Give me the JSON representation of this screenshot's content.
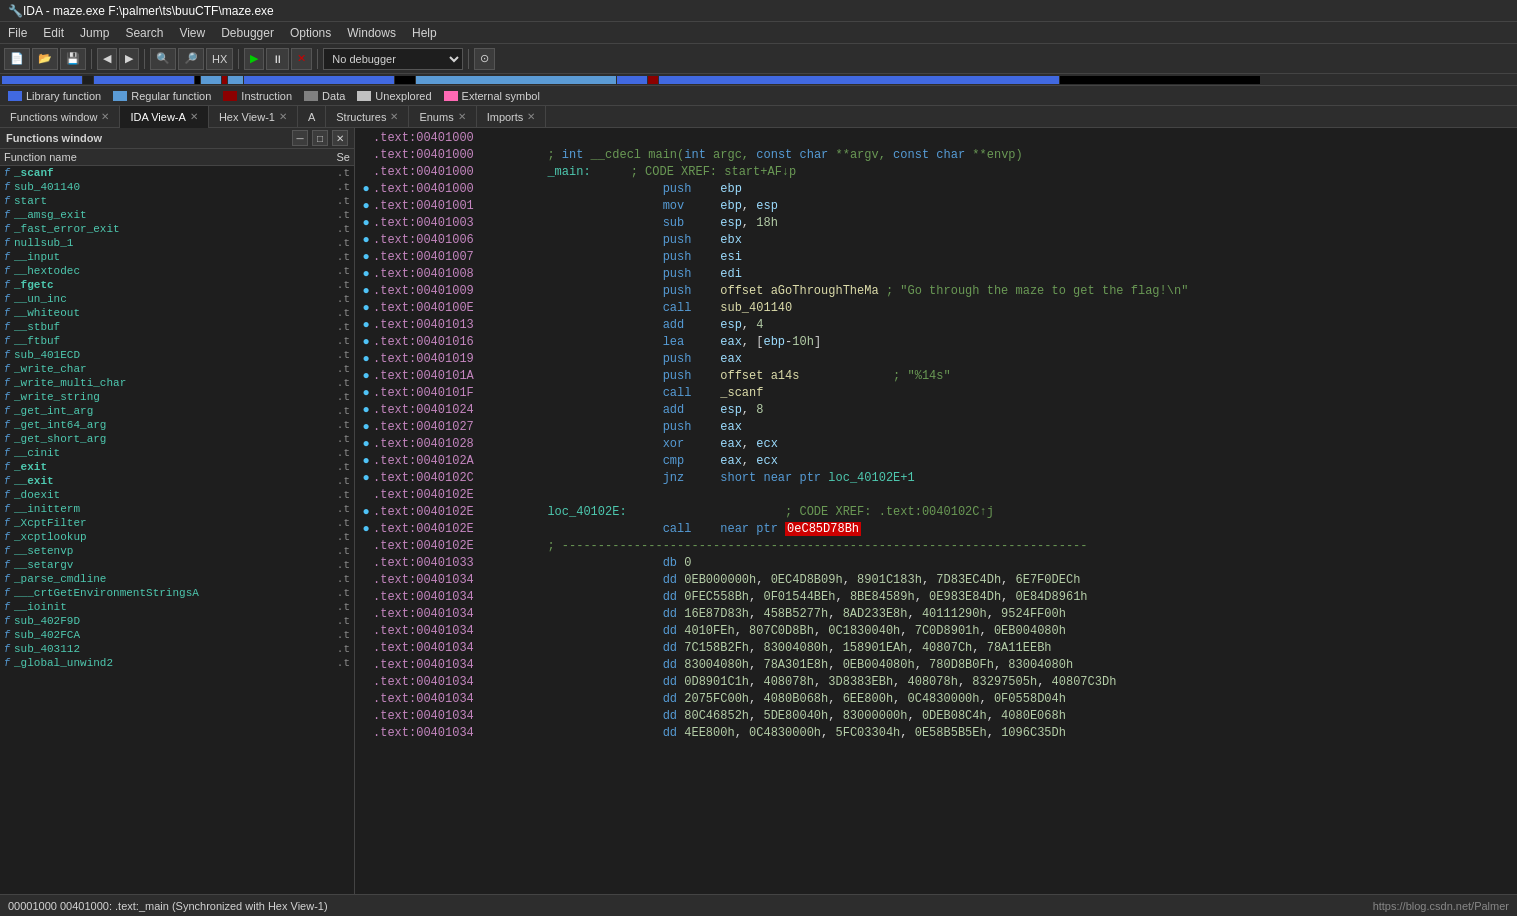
{
  "title_bar": {
    "icon": "🔧",
    "text": "IDA - maze.exe F:\\palmer\\ts\\buuCTF\\maze.exe"
  },
  "menu": {
    "items": [
      "File",
      "Edit",
      "Jump",
      "Search",
      "View",
      "Debugger",
      "Options",
      "Windows",
      "Help"
    ]
  },
  "legend": {
    "items": [
      {
        "color": "#4169e1",
        "label": "Library function"
      },
      {
        "color": "#5b9bd5",
        "label": "Regular function"
      },
      {
        "color": "#8b0000",
        "label": "Instruction"
      },
      {
        "color": "#808080",
        "label": "Data"
      },
      {
        "color": "#808080",
        "label": "Unexplored"
      },
      {
        "color": "#ff69b4",
        "label": "External symbol"
      }
    ]
  },
  "tabs": [
    {
      "label": "Functions window",
      "active": false,
      "closeable": true
    },
    {
      "label": "IDA View-A",
      "active": true,
      "closeable": true
    },
    {
      "label": "Hex View-1",
      "active": false,
      "closeable": true
    },
    {
      "label": "A",
      "active": false,
      "closeable": false
    },
    {
      "label": "Structures",
      "active": false,
      "closeable": true
    },
    {
      "label": "Enums",
      "active": false,
      "closeable": true
    },
    {
      "label": "Imports",
      "active": false,
      "closeable": true
    }
  ],
  "functions_panel": {
    "title": "Functions window",
    "col_name": "Function name",
    "col_seg": "Se",
    "functions": [
      {
        "name": "_scanf",
        "seg": ".t",
        "bold": true
      },
      {
        "name": "sub_401140",
        "seg": ".t",
        "bold": false
      },
      {
        "name": "start",
        "seg": ".t",
        "bold": false
      },
      {
        "name": "__amsg_exit",
        "seg": ".t",
        "bold": false
      },
      {
        "name": "_fast_error_exit",
        "seg": ".t",
        "bold": false
      },
      {
        "name": "nullsub_1",
        "seg": ".t",
        "bold": false
      },
      {
        "name": "__input",
        "seg": ".t",
        "bold": false
      },
      {
        "name": "__hextodec",
        "seg": ".t",
        "bold": false
      },
      {
        "name": "_fgetc",
        "seg": ".t",
        "bold": true
      },
      {
        "name": "__un_inc",
        "seg": ".t",
        "bold": false
      },
      {
        "name": "__whiteout",
        "seg": ".t",
        "bold": false
      },
      {
        "name": "__stbuf",
        "seg": ".t",
        "bold": false
      },
      {
        "name": "__ftbuf",
        "seg": ".t",
        "bold": false
      },
      {
        "name": "sub_401ECD",
        "seg": ".t",
        "bold": false
      },
      {
        "name": "_write_char",
        "seg": ".t",
        "bold": false
      },
      {
        "name": "_write_multi_char",
        "seg": ".t",
        "bold": false
      },
      {
        "name": "_write_string",
        "seg": ".t",
        "bold": false
      },
      {
        "name": "_get_int_arg",
        "seg": ".t",
        "bold": false
      },
      {
        "name": "_get_int64_arg",
        "seg": ".t",
        "bold": false
      },
      {
        "name": "_get_short_arg",
        "seg": ".t",
        "bold": false
      },
      {
        "name": "__cinit",
        "seg": ".t",
        "bold": false
      },
      {
        "name": "_exit",
        "seg": ".t",
        "bold": true
      },
      {
        "name": "__exit",
        "seg": ".t",
        "bold": true
      },
      {
        "name": "_doexit",
        "seg": ".t",
        "bold": false
      },
      {
        "name": "__initterm",
        "seg": ".t",
        "bold": false
      },
      {
        "name": "_XcptFilter",
        "seg": ".t",
        "bold": false
      },
      {
        "name": "_xcptlookup",
        "seg": ".t",
        "bold": false
      },
      {
        "name": "__setenvp",
        "seg": ".t",
        "bold": false
      },
      {
        "name": "__setargv",
        "seg": ".t",
        "bold": false
      },
      {
        "name": "_parse_cmdline",
        "seg": ".t",
        "bold": false
      },
      {
        "name": "___crtGetEnvironmentStringsA",
        "seg": ".t",
        "bold": false
      },
      {
        "name": "__ioinit",
        "seg": ".t",
        "bold": false
      },
      {
        "name": "sub_402F9D",
        "seg": ".t",
        "bold": false
      },
      {
        "name": "sub_402FCA",
        "seg": ".t",
        "bold": false
      },
      {
        "name": "sub_403112",
        "seg": ".t",
        "bold": false
      },
      {
        "name": "_global_unwind2",
        "seg": ".t",
        "bold": false
      }
    ]
  },
  "code": {
    "lines": [
      {
        "dot": "",
        "addr": ".text:00401000",
        "content": ""
      },
      {
        "dot": "",
        "addr": ".text:00401000",
        "content": "; int __cdecl main(int argc, const char **argv, const char **envp)",
        "type": "comment_green"
      },
      {
        "dot": "",
        "addr": ".text:00401000",
        "content": "_main:",
        "suffix_comment": "; CODE XREF: start+AF↓p",
        "type": "label"
      },
      {
        "dot": "●",
        "addr": ".text:00401000",
        "content": "                push    ebp"
      },
      {
        "dot": "●",
        "addr": ".text:00401001",
        "content": "                mov     ebp, esp"
      },
      {
        "dot": "●",
        "addr": ".text:00401003",
        "content": "                sub     esp, 18h"
      },
      {
        "dot": "●",
        "addr": ".text:00401006",
        "content": "                push    ebx"
      },
      {
        "dot": "●",
        "addr": ".text:00401007",
        "content": "                push    esi"
      },
      {
        "dot": "●",
        "addr": ".text:00401008",
        "content": "                push    edi"
      },
      {
        "dot": "●",
        "addr": ".text:00401009",
        "content": "                push    offset aGoThroughTheMa",
        "comment": "; \"Go through the maze to get the flag!\\n\""
      },
      {
        "dot": "●",
        "addr": ".text:0040100E",
        "content": "                call    sub_401140"
      },
      {
        "dot": "●",
        "addr": ".text:00401013",
        "content": "                add     esp, 4"
      },
      {
        "dot": "●",
        "addr": ".text:00401016",
        "content": "                lea     eax, [ebp-10h]"
      },
      {
        "dot": "●",
        "addr": ".text:00401019",
        "content": "                push    eax"
      },
      {
        "dot": "●",
        "addr": ".text:0040101A",
        "content": "                push    offset a14s",
        "comment": "; \"%14s\""
      },
      {
        "dot": "●",
        "addr": ".text:0040101F",
        "content": "                call    _scanf"
      },
      {
        "dot": "●",
        "addr": ".text:00401024",
        "content": "                add     esp, 8"
      },
      {
        "dot": "●",
        "addr": ".text:00401027",
        "content": "                push    eax"
      },
      {
        "dot": "●",
        "addr": ".text:00401028",
        "content": "                xor     eax, ecx"
      },
      {
        "dot": "●",
        "addr": ".text:0040102A",
        "content": "                cmp     eax, ecx"
      },
      {
        "dot": "●",
        "addr": ".text:0040102C",
        "content": "                jnz     short near ptr loc_40102E+1"
      },
      {
        "dot": "",
        "addr": ".text:0040102E",
        "content": ""
      },
      {
        "dot": "●",
        "addr": ".text:0040102E",
        "content": "loc_40102E:",
        "suffix_comment": "                   ; CODE XREF: .text:0040102C↑j",
        "type": "label"
      },
      {
        "dot": "●",
        "addr": ".text:0040102E",
        "content": "                call    near ptr 0eC85D78Bh",
        "highlight": "0eC85D78Bh"
      },
      {
        "dot": "",
        "addr": ".text:0040102E",
        "content": "; -------------------------------------------------------------------------"
      },
      {
        "dot": "",
        "addr": ".text:00401033",
        "content": "                db 0"
      },
      {
        "dot": "",
        "addr": ".text:00401034",
        "content": "                dd 0EB000000h, 0EC4D8B09h, 8901C183h, 7D83EC4Dh, 6E7F0DECh"
      },
      {
        "dot": "",
        "addr": ".text:00401034",
        "content": "                dd 0FEC558Bh, 0F01544BEh, 8BE84589h, 0E983E84Dh, 0E84D8961h"
      },
      {
        "dot": "",
        "addr": ".text:00401034",
        "content": "                dd 16E87D83h, 458B5277h, 8AD233E8h, 40111290h, 9524FF00h"
      },
      {
        "dot": "",
        "addr": ".text:00401034",
        "content": "                dd 4010FEh, 807C0D8Bh, 0C1830040h, 7C0D8901h, 0EB004080h"
      },
      {
        "dot": "",
        "addr": ".text:00401034",
        "content": "                dd 7C158B2Fh, 83004080h, 158901EAh, 40807Ch, 78A11EEBh"
      },
      {
        "dot": "",
        "addr": ".text:00401034",
        "content": "                dd 83004080h, 78A301E8h, 0EB004080h, 780D8B0Fh, 83004080h"
      },
      {
        "dot": "",
        "addr": ".text:00401034",
        "content": "                dd 0D8901C1h, 408078h, 3D8383EBh, 408078h, 83297505h, 40807C3Dh"
      },
      {
        "dot": "",
        "addr": ".text:00401034",
        "content": "                dd 2075FC00h, 4080B068h, 6EE800h, 0C4830000h, 0F0558D04h"
      },
      {
        "dot": "",
        "addr": ".text:00401034",
        "content": "                dd 80C46852h, 5DE80040h, 83000000h, 0DEB08C4h, 4080E068h"
      },
      {
        "dot": "",
        "addr": ".text:00401034",
        "content": "                dd 4EE800h, 0C4830000h, 5FC03304h, 0E58B5B5Eh, 1096C35Dh"
      }
    ]
  },
  "status_bar": {
    "left": "00001000 00401000: .text:_main (Synchronized with Hex View-1)",
    "right": "https://blog.csdn.net/Palmer"
  },
  "debugger": {
    "label": "No debugger"
  }
}
